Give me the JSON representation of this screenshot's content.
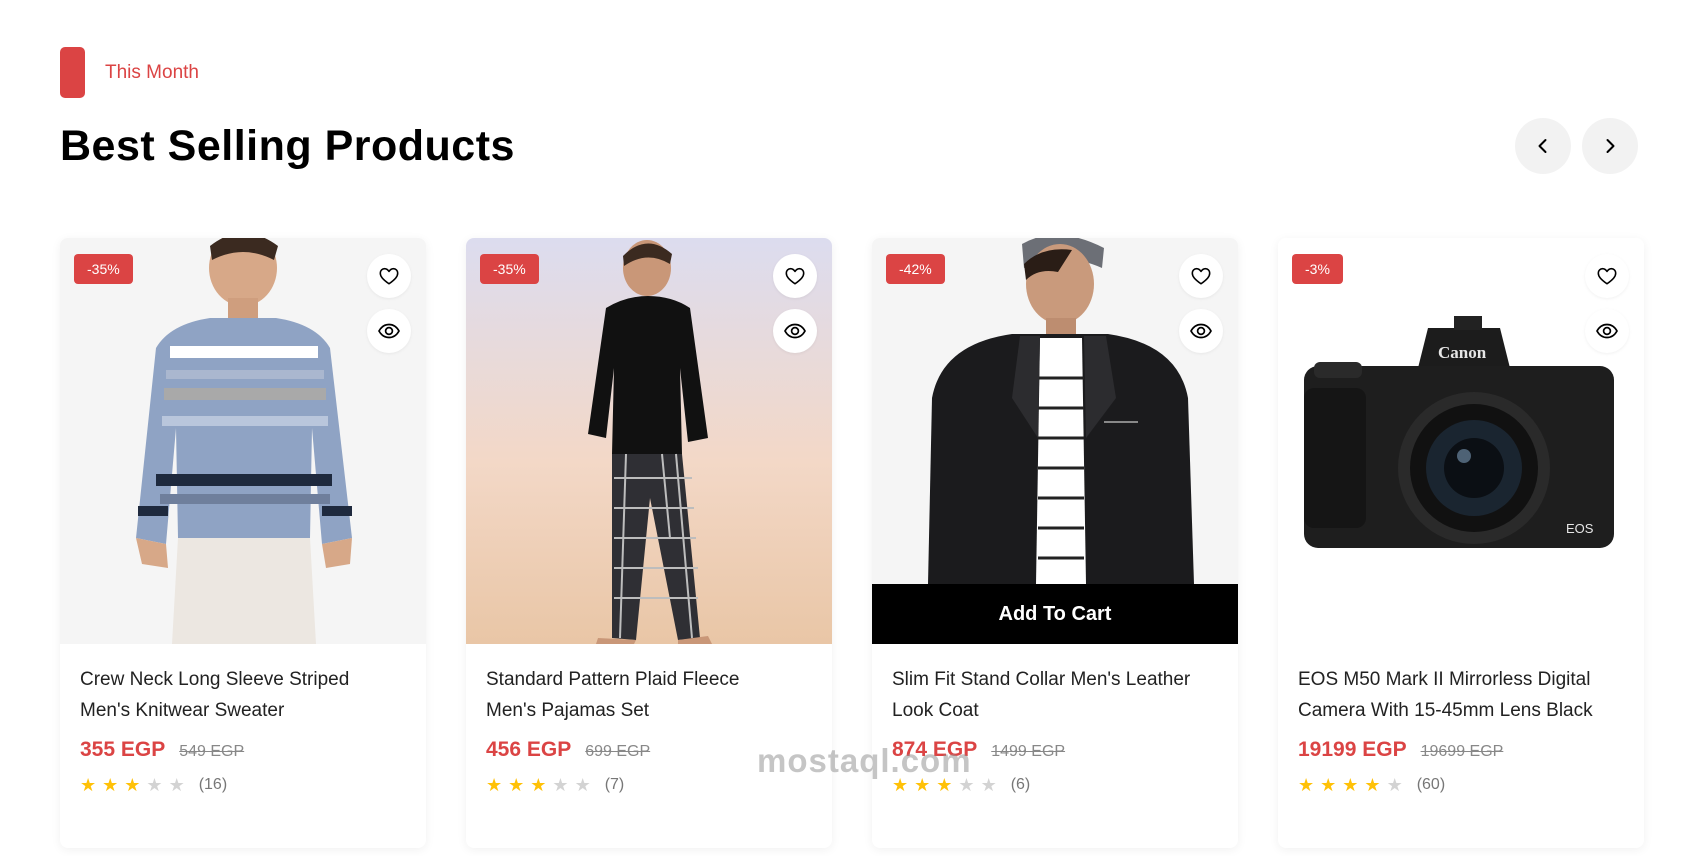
{
  "header": {
    "eyebrow": "This Month",
    "title": "Best Selling Products",
    "prev_icon": "chevron-left-icon",
    "next_icon": "chevron-right-icon"
  },
  "colors": {
    "accent": "#DB4444",
    "star": "#FFC107",
    "star_off": "#D3D3D3"
  },
  "products": [
    {
      "discount": "-35%",
      "name_line1": "Crew Neck Long Sleeve Striped",
      "name_line2": "Men's Knitwear Sweater",
      "price": "355 EGP",
      "old_price": "549 EGP",
      "rating": 3,
      "reviews": "(16)"
    },
    {
      "discount": "-35%",
      "name_line1": "Standard Pattern Plaid Fleece",
      "name_line2": "Men's Pajamas Set",
      "price": "456 EGP",
      "old_price": "699 EGP",
      "rating": 3,
      "reviews": "(7)"
    },
    {
      "discount": "-42%",
      "name_line1": "Slim Fit Stand Collar Men's Leather",
      "name_line2": "Look Coat",
      "price": "874 EGP",
      "old_price": "1499 EGP",
      "rating": 3,
      "reviews": "(6)",
      "add_to_cart": "Add To Cart"
    },
    {
      "discount": "-3%",
      "name_line1": "EOS M50 Mark II Mirrorless Digital",
      "name_line2": "Camera With 15-45mm Lens Black",
      "price": "19199 EGP",
      "old_price": "19699 EGP",
      "rating": 4,
      "reviews": "(60)"
    }
  ],
  "camera_brand": "Canon",
  "camera_model": "EOS",
  "watermark": "mostaql.com"
}
